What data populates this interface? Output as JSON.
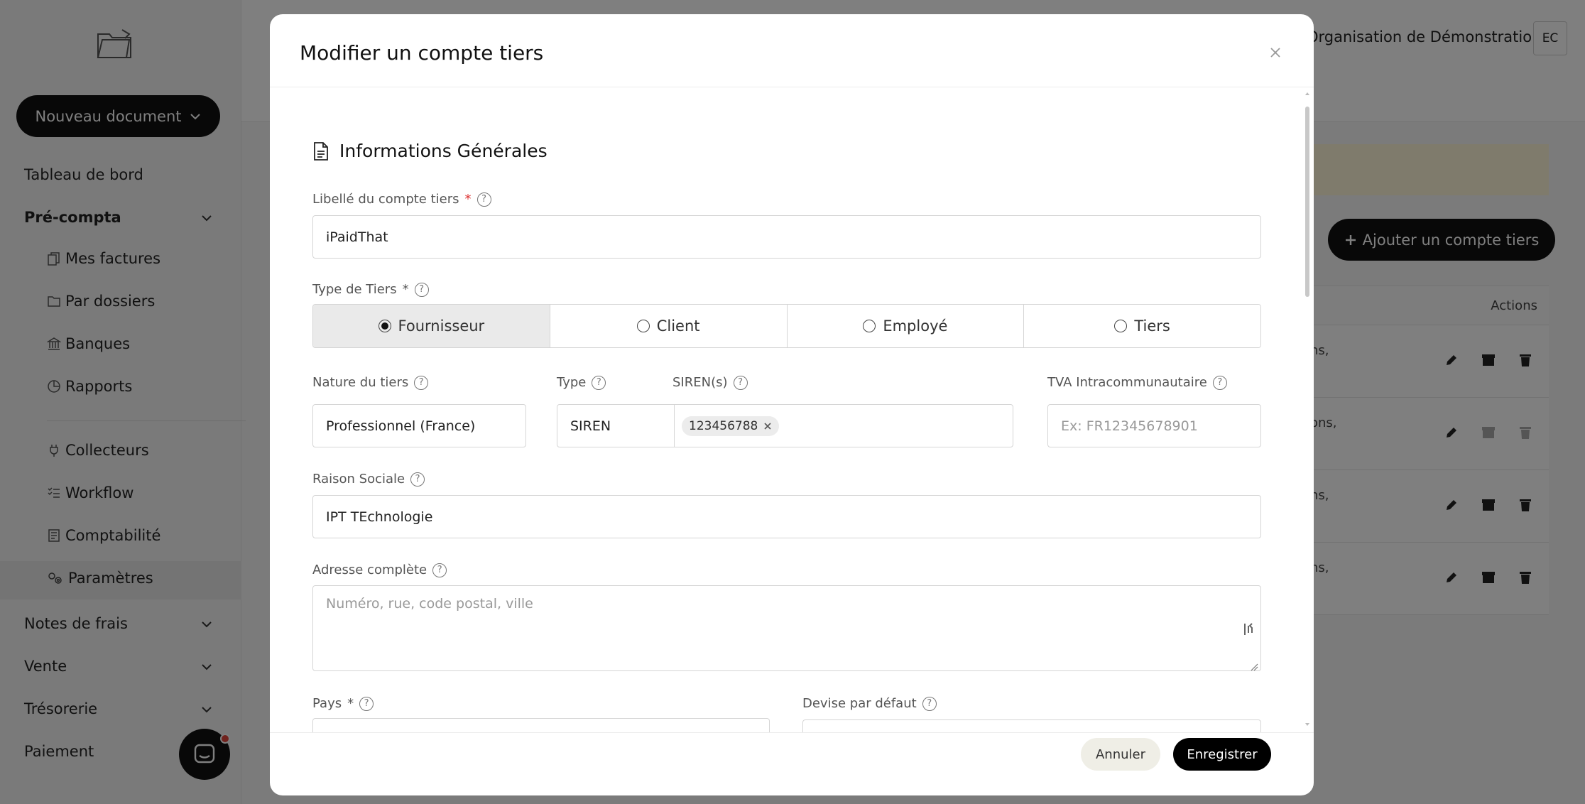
{
  "sidebar": {
    "new_document": "Nouveau document",
    "items": [
      {
        "label": "Tableau de bord"
      },
      {
        "label": "Pré-compta"
      },
      {
        "label": "Mes factures"
      },
      {
        "label": "Par dossiers"
      },
      {
        "label": "Banques"
      },
      {
        "label": "Rapports"
      },
      {
        "label": "Collecteurs"
      },
      {
        "label": "Workflow"
      },
      {
        "label": "Comptabilité"
      },
      {
        "label": "Paramètres"
      },
      {
        "label": "Notes de frais"
      },
      {
        "label": "Vente"
      },
      {
        "label": "Trésorerie"
      },
      {
        "label": "Paiement"
      }
    ]
  },
  "header": {
    "org_name": "Organisation de Démonstration",
    "avatar": "EC"
  },
  "page": {
    "add_button": "Ajouter un compte tiers",
    "actions_header": "Actions",
    "row_fragments": [
      "ns,",
      "ons,",
      "ns,",
      "ns,"
    ]
  },
  "modal": {
    "title": "Modifier un compte tiers",
    "section_title": "Informations Générales",
    "label_libelle": "Libellé du compte tiers",
    "value_libelle": "iPaidThat",
    "label_type_tiers": "Type de Tiers",
    "type_options": [
      {
        "label": "Fournisseur",
        "selected": true
      },
      {
        "label": "Client",
        "selected": false
      },
      {
        "label": "Employé",
        "selected": false
      },
      {
        "label": "Tiers",
        "selected": false
      }
    ],
    "label_nature": "Nature du tiers",
    "value_nature": "Professionnel (France)",
    "label_type": "Type",
    "value_type": "SIREN",
    "label_siren": "SIREN(s)",
    "siren_tags": [
      "123456788"
    ],
    "label_tva": "TVA Intracommunautaire",
    "placeholder_tva": "Ex: FR12345678901",
    "label_raison": "Raison Sociale",
    "value_raison": "IPT TEchnologie",
    "label_adresse": "Adresse complète",
    "placeholder_adresse": "Numéro, rue, code postal, ville",
    "label_pays": "Pays",
    "label_devise": "Devise par défaut",
    "cancel": "Annuler",
    "save": "Enregistrer"
  }
}
